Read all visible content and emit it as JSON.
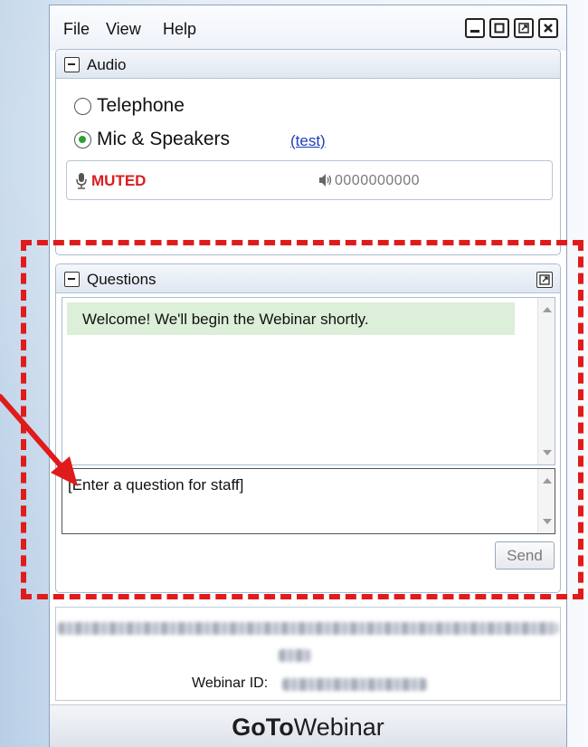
{
  "menubar": {
    "items": [
      "File",
      "View",
      "Help"
    ],
    "window_controls": [
      "minimize-icon",
      "maximize-icon",
      "popout-icon",
      "close-icon"
    ]
  },
  "audio": {
    "title": "Audio",
    "options": [
      {
        "label": "Telephone",
        "selected": false
      },
      {
        "label": "Mic & Speakers",
        "selected": true
      }
    ],
    "test_link": "(test)",
    "status": "MUTED",
    "volume_meter": "0000000000"
  },
  "questions": {
    "title": "Questions",
    "log": [
      {
        "text": "Welcome! We'll begin the Webinar shortly."
      }
    ],
    "input_placeholder": "[Enter a question for staff]",
    "send_label": "Send"
  },
  "info": {
    "webinar_id_label": "Webinar ID:"
  },
  "footer": {
    "brand_bold": "GoTo",
    "brand_regular": "Webinar"
  },
  "colors": {
    "muted_red": "#d8201f",
    "annotation_red": "#e01b1b",
    "welcome_bg": "#dcefd8",
    "link_blue": "#1b3fb8"
  }
}
